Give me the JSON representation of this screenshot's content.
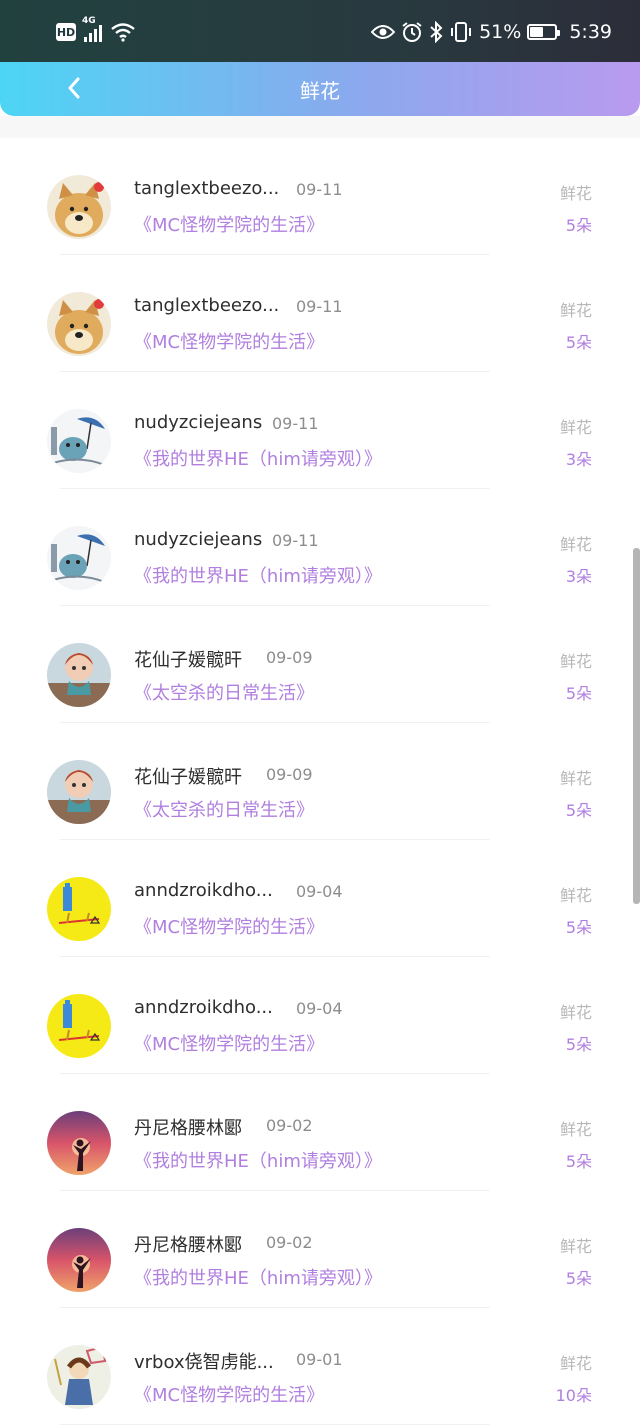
{
  "status_bar": {
    "hd": "HD",
    "network": "4G",
    "battery_percent": "51%",
    "battery_level": 0.51,
    "time": "5:39",
    "icons": [
      "eye-icon",
      "alarm-icon",
      "bluetooth-icon",
      "vibrate-icon"
    ]
  },
  "header": {
    "back_icon": "chevron-left-icon",
    "title": "鲜花"
  },
  "rows": [
    {
      "user": "tanglextbeezo...",
      "date": "09-11",
      "book": "《MC怪物学院的生活》",
      "label": "鲜花",
      "count": "5朵",
      "avatar": "doge"
    },
    {
      "user": "tanglextbeezo...",
      "date": "09-11",
      "book": "《MC怪物学院的生活》",
      "label": "鲜花",
      "count": "5朵",
      "avatar": "doge"
    },
    {
      "user": "nudyzciejeans",
      "date": "09-11",
      "book": "《我的世界HE（him请旁观）》",
      "label": "鲜花",
      "count": "3朵",
      "avatar": "sketch"
    },
    {
      "user": "nudyzciejeans",
      "date": "09-11",
      "book": "《我的世界HE（him请旁观）》",
      "label": "鲜花",
      "count": "3朵",
      "avatar": "sketch"
    },
    {
      "user": "花仙子媛髋旰",
      "date": "09-09",
      "book": "《太空杀的日常生活》",
      "label": "鲜花",
      "count": "5朵",
      "avatar": "doll"
    },
    {
      "user": "花仙子媛髋旰",
      "date": "09-09",
      "book": "《太空杀的日常生活》",
      "label": "鲜花",
      "count": "5朵",
      "avatar": "doll"
    },
    {
      "user": "anndzroikdho...",
      "date": "09-04",
      "book": "《MC怪物学院的生活》",
      "label": "鲜花",
      "count": "5朵",
      "avatar": "yellow"
    },
    {
      "user": "anndzroikdho...",
      "date": "09-04",
      "book": "《MC怪物学院的生活》",
      "label": "鲜花",
      "count": "5朵",
      "avatar": "yellow"
    },
    {
      "user": "丹尼格腰林郾",
      "date": "09-02",
      "book": "《我的世界HE（him请旁观）》",
      "label": "鲜花",
      "count": "5朵",
      "avatar": "sunset"
    },
    {
      "user": "丹尼格腰林郾",
      "date": "09-02",
      "book": "《我的世界HE（him请旁观）》",
      "label": "鲜花",
      "count": "5朵",
      "avatar": "sunset"
    },
    {
      "user": "vrbox侥智虏能...",
      "date": "09-01",
      "book": "《MC怪物学院的生活》",
      "label": "鲜花",
      "count": "10朵",
      "avatar": "drawing"
    }
  ]
}
